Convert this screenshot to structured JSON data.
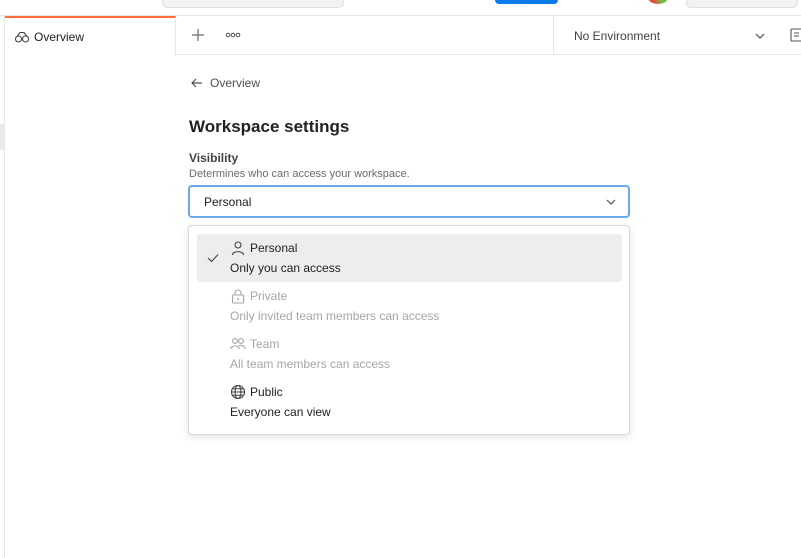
{
  "tabs": {
    "active_label": "Overview"
  },
  "environment": {
    "selected": "No Environment"
  },
  "breadcrumb": {
    "back_label": "Overview"
  },
  "page": {
    "title": "Workspace settings"
  },
  "visibility": {
    "label": "Visibility",
    "description": "Determines who can access your workspace.",
    "selected": "Personal",
    "options": [
      {
        "name": "Personal",
        "description": "Only you can access",
        "icon": "person-icon",
        "selected": true,
        "disabled": false
      },
      {
        "name": "Private",
        "description": "Only invited team members can access",
        "icon": "lock-icon",
        "selected": false,
        "disabled": true
      },
      {
        "name": "Team",
        "description": "All team members can access",
        "icon": "team-icon",
        "selected": false,
        "disabled": true
      },
      {
        "name": "Public",
        "description": "Everyone can view",
        "icon": "globe-icon",
        "selected": false,
        "disabled": false
      }
    ]
  },
  "colors": {
    "active_tab_accent": "#ff6c37",
    "focus_border": "#6aa8ef",
    "primary_button": "#097bed"
  }
}
